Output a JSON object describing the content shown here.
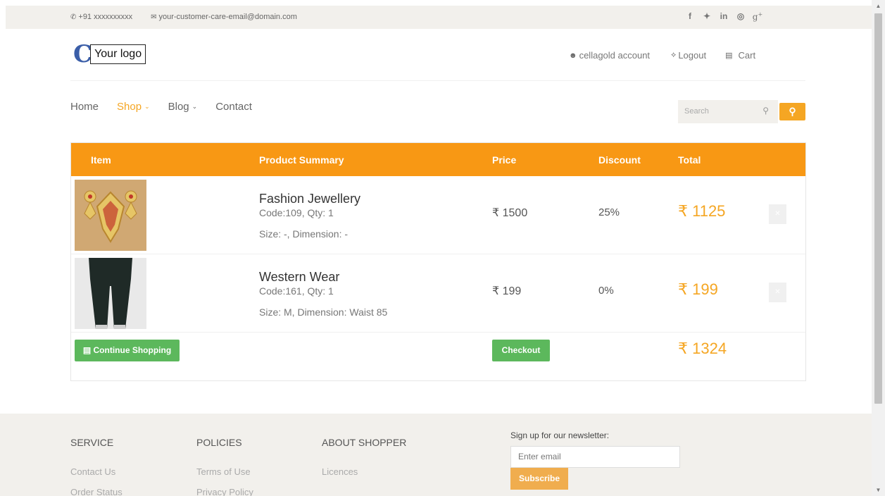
{
  "topbar": {
    "phone": "+91 xxxxxxxxxx",
    "email": "your-customer-care-email@domain.com",
    "social": [
      "f",
      "y",
      "in",
      "d",
      "g+"
    ]
  },
  "header": {
    "logo_letter": "C",
    "logo_text": "Your logo",
    "account_label": "cellagold account",
    "logout_label": "Logout",
    "cart_label": "Cart"
  },
  "nav": {
    "items": [
      "Home",
      "Shop",
      "Blog",
      "Contact"
    ],
    "active": "Shop",
    "search_placeholder": "Search"
  },
  "cart": {
    "columns": [
      "Item",
      "Product Summary",
      "Price",
      "Discount",
      "Total"
    ],
    "rows": [
      {
        "name": "Fashion Jewellery",
        "code": "Code:109, Qty: 1",
        "size": "Size: -, Dimension: -",
        "price": "₹ 1500",
        "discount": "25%",
        "total": "₹ 1125"
      },
      {
        "name": "Western Wear",
        "code": "Code:161, Qty: 1",
        "size": "Size: M, Dimension: Waist 85",
        "price": "₹ 199",
        "discount": "0%",
        "total": "₹ 199"
      }
    ],
    "continue_label": "Continue Shopping",
    "checkout_label": "Checkout",
    "grand_total": "₹ 1324"
  },
  "footer": {
    "columns": [
      {
        "heading": "SERVICE",
        "links": [
          "Contact Us",
          "Order Status"
        ]
      },
      {
        "heading": "POLICIES",
        "links": [
          "Terms of Use",
          "Privacy Policy"
        ]
      },
      {
        "heading": "ABOUT SHOPPER",
        "links": [
          "Licences",
          ""
        ]
      }
    ],
    "newsletter_label": "Sign up for our newsletter:",
    "email_placeholder": "Enter email",
    "subscribe_label": "Subscribe"
  },
  "colors": {
    "accent": "#f5a623",
    "header_bg": "#f89814",
    "button_green": "#5cb85c",
    "footer_bg": "#f2f0ec"
  }
}
